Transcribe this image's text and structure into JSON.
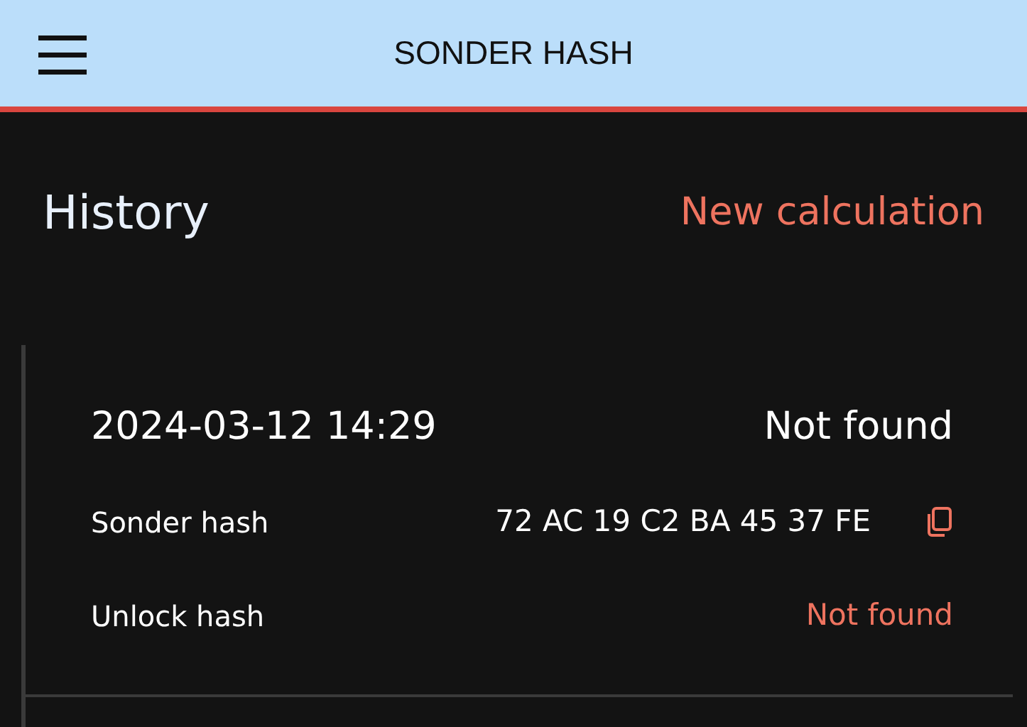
{
  "app_bar": {
    "title": "SONDER HASH"
  },
  "history": {
    "title": "History",
    "action": "New calculation"
  },
  "entries": [
    {
      "date": "2024-03-12 14:29",
      "status": "Not found",
      "rows": [
        {
          "kind": "hash",
          "label": "Sonder hash",
          "value": "72 AC 19 C2 BA 45 37 FE"
        },
        {
          "kind": "missing",
          "label": "Unlock hash",
          "value": "Not found"
        }
      ]
    }
  ]
}
